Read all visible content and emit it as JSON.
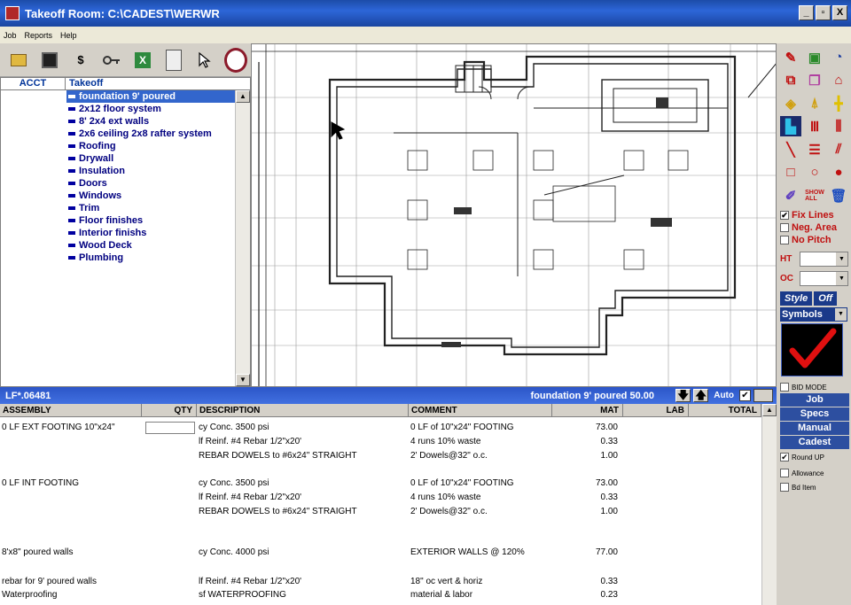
{
  "window": {
    "title": "Takeoff Room: C:\\CADEST\\WERWR",
    "min": "_",
    "max": "▫",
    "close": "X"
  },
  "menu": [
    "Job",
    "Reports",
    "Help"
  ],
  "toolbar": {
    "dollar": "$"
  },
  "tree": {
    "col_acct": "ACCT",
    "col_takeoff": "Takeoff",
    "items": [
      "foundation 9' poured",
      "2x12 floor system",
      "8' 2x4 ext walls",
      "2x6 ceiling 2x8 rafter system",
      "Roofing",
      "Drywall",
      "Insulation",
      "Doors",
      "Windows",
      "Trim",
      "Floor finishes",
      "Interior finishs",
      "Wood Deck",
      "Plumbing"
    ],
    "selected_index": 0
  },
  "tools_panel": {
    "fix_lines": "Fix Lines",
    "neg_area": "Neg. Area",
    "no_pitch": "No Pitch",
    "ht_label": "HT",
    "oc_label": "OC",
    "style": "Style",
    "off": "Off",
    "symbols": "Symbols",
    "bid_mode": "BID MODE",
    "job": "Job",
    "specs": "Specs",
    "manual": "Manual",
    "cadest": "Cadest",
    "round_up": "Round UP",
    "allowance": "Allowance",
    "bid_item": "Bd Item",
    "fix_lines_checked": true,
    "round_up_checked": true
  },
  "assembly_bar": {
    "lf": "LF*.06481",
    "status": "foundation 9' poured 50.00",
    "auto": "Auto",
    "auto_checked": true
  },
  "grid": {
    "headers": {
      "assembly": "ASSEMBLY",
      "qty": "QTY",
      "description": "DESCRIPTION",
      "comment": "COMMENT",
      "mat": "MAT",
      "lab": "LAB",
      "total": "TOTAL"
    },
    "rows": [
      {
        "assembly": "0 LF EXT FOOTING 10\"x24\"",
        "description": "cy Conc. 3500 psi",
        "comment": "0 LF of 10\"x24\" FOOTING",
        "mat": "73.00",
        "qty_box": true
      },
      {
        "assembly": "",
        "description": "lf Reinf. #4 Rebar 1/2\"x20'",
        "comment": "4 runs 10% waste",
        "mat": "0.33"
      },
      {
        "assembly": "",
        "description": "REBAR DOWELS to #6x24\" STRAIGHT",
        "comment": "2' Dowels@32\" o.c.",
        "mat": "1.00"
      },
      {
        "assembly": "0 LF INT FOOTING",
        "description": "cy Conc. 3500 psi",
        "comment": "0 LF of 10\"x24\" FOOTING",
        "mat": "73.00"
      },
      {
        "assembly": "",
        "description": "lf Reinf. #4 Rebar 1/2\"x20'",
        "comment": "4 runs 10% waste",
        "mat": "0.33"
      },
      {
        "assembly": "",
        "description": "REBAR DOWELS to #6x24\" STRAIGHT",
        "comment": "2' Dowels@32\" o.c.",
        "mat": "1.00"
      },
      {
        "assembly": "8'x8\" poured walls",
        "description": "cy Conc. 4000 psi",
        "comment": "EXTERIOR WALLS @ 120%",
        "mat": "77.00"
      },
      {
        "assembly": "rebar for 9' poured walls",
        "description": "lf Reinf. #4 Rebar 1/2\"x20'",
        "comment": "18\" oc vert & horiz",
        "mat": "0.33"
      },
      {
        "assembly": "Waterproofing",
        "description": "sf WATERPROOFING",
        "comment": "material & labor",
        "mat": "0.23"
      }
    ]
  }
}
